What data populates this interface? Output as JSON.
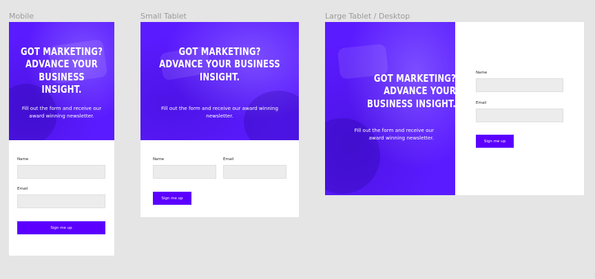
{
  "frames": [
    {
      "label": "Mobile"
    },
    {
      "label": "Small Tablet"
    },
    {
      "label": "Large Tablet / Desktop"
    }
  ],
  "hero": {
    "headline_mobile": [
      "GOT MARKETING?",
      "ADVANCE YOUR",
      "BUSINESS INSIGHT."
    ],
    "headline_tablet": [
      "GOT MARKETING?",
      "ADVANCE YOUR BUSINESS",
      "INSIGHT."
    ],
    "headline_desktop": [
      "GOT MARKETING?",
      "ADVANCE YOUR",
      "BUSINESS INSIGHT."
    ],
    "subtext_mobile": [
      "Fill out the form and receive our",
      "award winning newsletter."
    ],
    "subtext_tablet": [
      "Fill out the form and receive our award winning",
      "newsletter."
    ],
    "subtext_desktop": [
      "Fill out the form and receive our",
      "award winning newsletter."
    ],
    "color": "#5b1bff"
  },
  "form": {
    "name_label": "Name",
    "email_label": "Email",
    "submit_label": "Sign me up",
    "button_color": "#5b00ff"
  }
}
